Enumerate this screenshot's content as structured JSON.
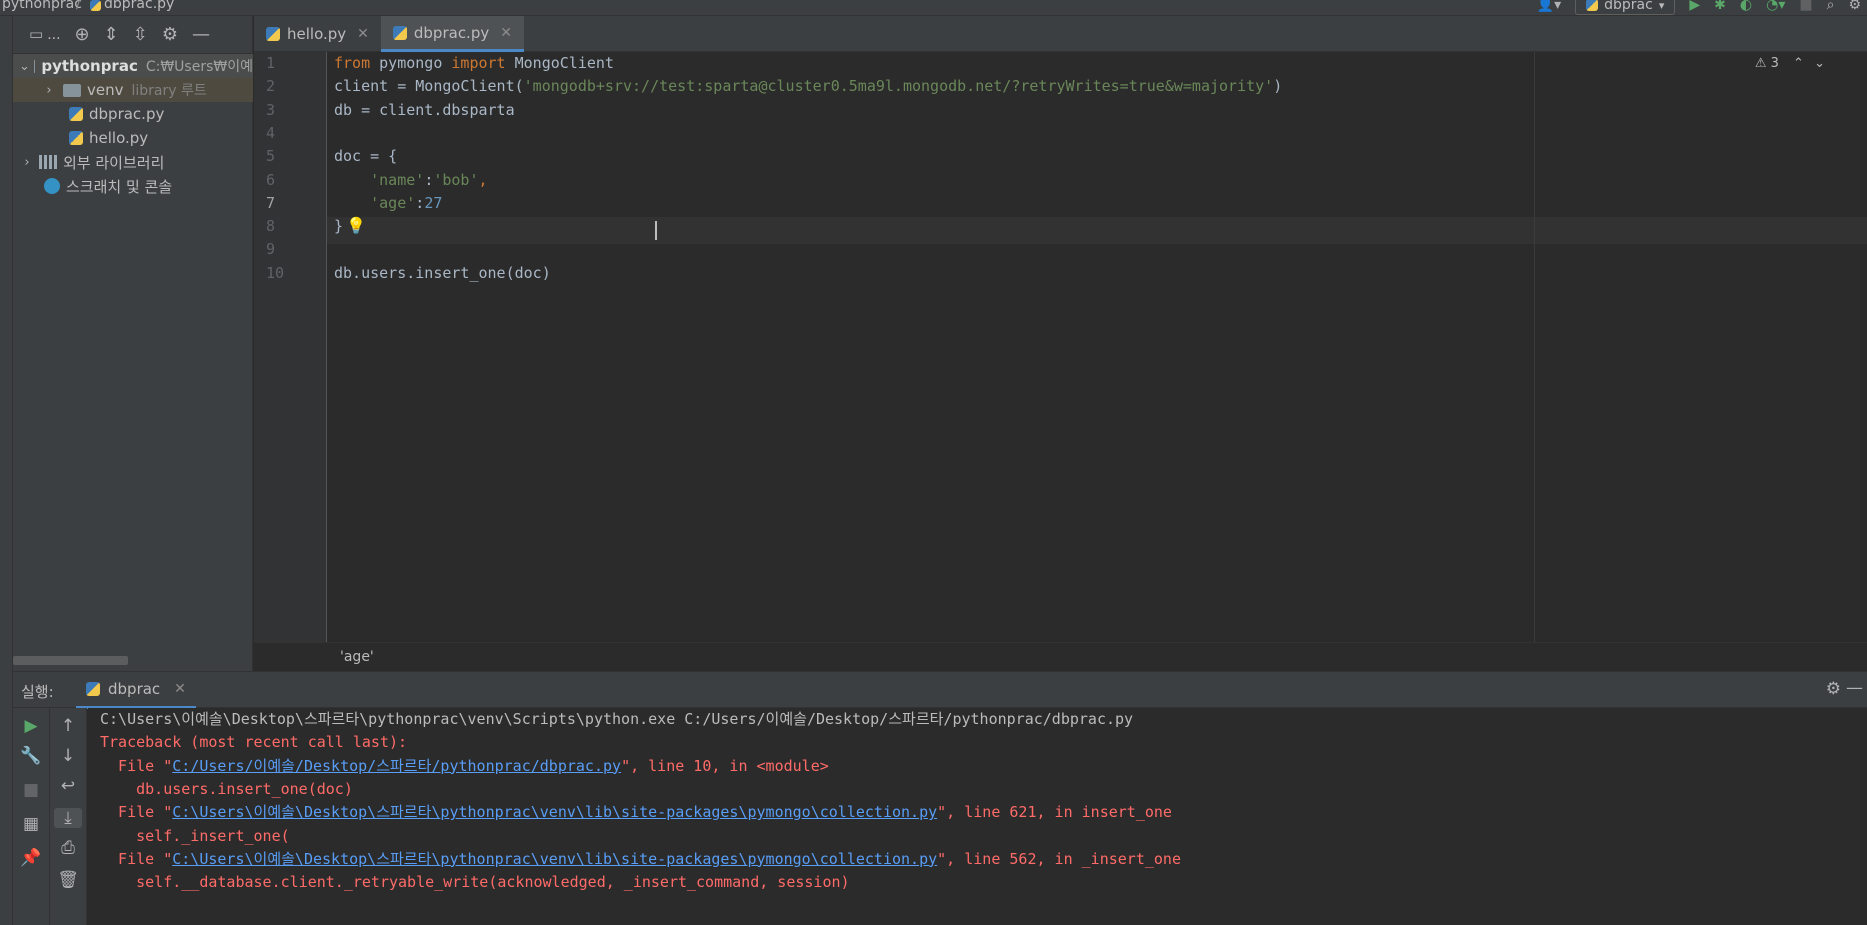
{
  "title_bar": {
    "breadcrumb": [
      "pythonprac",
      "dbprac.py"
    ],
    "run_config": "dbprac"
  },
  "project": {
    "toolbar_label": "...",
    "tree": [
      {
        "label": "pythonprac",
        "extra": "C:₩Users₩이예",
        "expanded": true
      },
      {
        "label": "venv",
        "extra": "library 루트",
        "expanded": false
      },
      {
        "label": "dbprac.py",
        "extra": ""
      },
      {
        "label": "hello.py",
        "extra": ""
      },
      {
        "label": "외부 라이브러리",
        "extra": ""
      },
      {
        "label": "스크래치 및 콘솔",
        "extra": ""
      }
    ]
  },
  "tabs": [
    {
      "label": "hello.py",
      "active": false
    },
    {
      "label": "dbprac.py",
      "active": true
    }
  ],
  "editor": {
    "warnings": "3",
    "line_numbers": [
      "1",
      "2",
      "3",
      "4",
      "5",
      "6",
      "7",
      "8",
      "9",
      "10"
    ],
    "current_line": 7,
    "lines": [
      [
        {
          "t": "from",
          "c": "kw"
        },
        {
          "t": " pymongo ",
          "c": ""
        },
        {
          "t": "import",
          "c": "kw"
        },
        {
          "t": " MongoClient",
          "c": ""
        }
      ],
      [
        {
          "t": "client = MongoClient(",
          "c": ""
        },
        {
          "t": "'mongodb+srv://test:sparta@cluster0.5ma9l.mongodb.net/?retryWrites=true&w=majority'",
          "c": "str"
        },
        {
          "t": ")",
          "c": ""
        }
      ],
      [
        {
          "t": "db = client.dbsparta",
          "c": ""
        }
      ],
      [],
      [
        {
          "t": "doc = {",
          "c": ""
        }
      ],
      [
        {
          "t": "    ",
          "c": ""
        },
        {
          "t": "'name'",
          "c": "str"
        },
        {
          "t": ":",
          "c": ""
        },
        {
          "t": "'bob'",
          "c": "str"
        },
        {
          "t": ",",
          "c": "kw"
        }
      ],
      [
        {
          "t": "    ",
          "c": ""
        },
        {
          "t": "'age'",
          "c": "str"
        },
        {
          "t": ":",
          "c": ""
        },
        {
          "t": "27",
          "c": "num"
        }
      ],
      [
        {
          "t": "}",
          "c": ""
        }
      ],
      [],
      [
        {
          "t": "db.users.insert_one(doc)",
          "c": ""
        }
      ]
    ]
  },
  "breadcrumb_bar": "'age'",
  "run_panel": {
    "label": "실행:",
    "tab": "dbprac",
    "console": [
      [
        {
          "t": "C:\\Users\\이예솔\\Desktop\\스파르타\\pythonprac\\venv\\Scripts\\python.exe C:/Users/이예솔/Desktop/스파르타/pythonprac/dbprac.py",
          "c": ""
        }
      ],
      [
        {
          "t": "Traceback (most recent call last):",
          "c": "err"
        }
      ],
      [
        {
          "t": "  File \"",
          "c": "err"
        },
        {
          "t": "C:/Users/이예솔/Desktop/스파르타/pythonprac/dbprac.py",
          "c": "link"
        },
        {
          "t": "\", line 10, in <module>",
          "c": "err"
        }
      ],
      [
        {
          "t": "    db.users.insert_one(doc)",
          "c": "err"
        }
      ],
      [
        {
          "t": "  File \"",
          "c": "err"
        },
        {
          "t": "C:\\Users\\이예솔\\Desktop\\스파르타\\pythonprac\\venv\\lib\\site-packages\\pymongo\\collection.py",
          "c": "link"
        },
        {
          "t": "\", line 621, in insert_one",
          "c": "err"
        }
      ],
      [
        {
          "t": "    self._insert_one(",
          "c": "err"
        }
      ],
      [
        {
          "t": "  File \"",
          "c": "err"
        },
        {
          "t": "C:\\Users\\이예솔\\Desktop\\스파르타\\pythonprac\\venv\\lib\\site-packages\\pymongo\\collection.py",
          "c": "link"
        },
        {
          "t": "\", line 562, in _insert_one",
          "c": "err"
        }
      ],
      [
        {
          "t": "    self.__database.client._retryable_write(acknowledged, _insert_command, session)",
          "c": "err"
        }
      ]
    ]
  }
}
